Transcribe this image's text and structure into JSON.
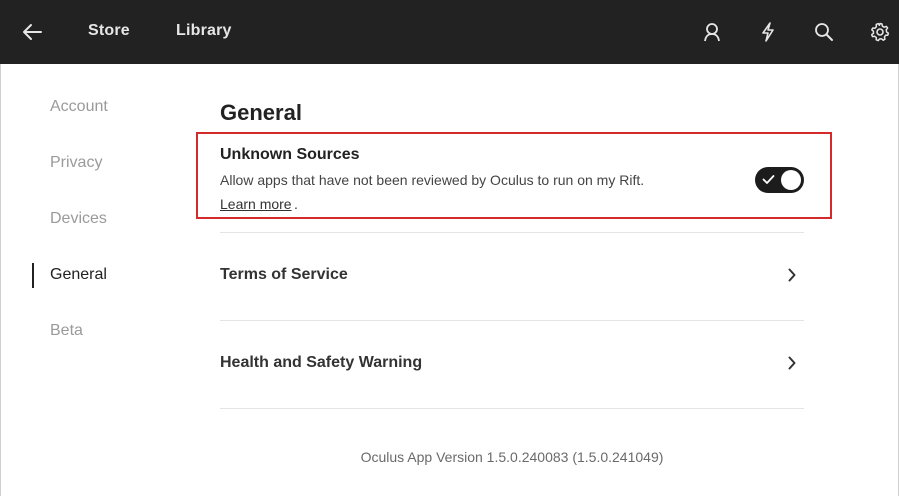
{
  "header": {
    "back_icon": "arrow-left-icon",
    "tabs": [
      {
        "label": "Store"
      },
      {
        "label": "Library"
      }
    ],
    "icons": [
      "user-icon",
      "lightning-icon",
      "search-icon",
      "gear-icon"
    ]
  },
  "sidebar": {
    "items": [
      {
        "label": "Account"
      },
      {
        "label": "Privacy"
      },
      {
        "label": "Devices"
      },
      {
        "label": "General",
        "active": true
      },
      {
        "label": "Beta"
      }
    ]
  },
  "main": {
    "title": "General",
    "unknown_sources": {
      "title": "Unknown Sources",
      "description": "Allow apps that have not been reviewed by Oculus to run on my Rift.",
      "learn_more": "Learn more",
      "learn_more_suffix": ".",
      "enabled": true
    },
    "links": [
      {
        "label": "Terms of Service"
      },
      {
        "label": "Health and Safety Warning"
      }
    ],
    "version": "Oculus App Version 1.5.0.240083 (1.5.0.241049)"
  },
  "colors": {
    "header_bg": "#222222",
    "highlight": "#d42a2a",
    "toggle_on": "#1c1c1c"
  }
}
